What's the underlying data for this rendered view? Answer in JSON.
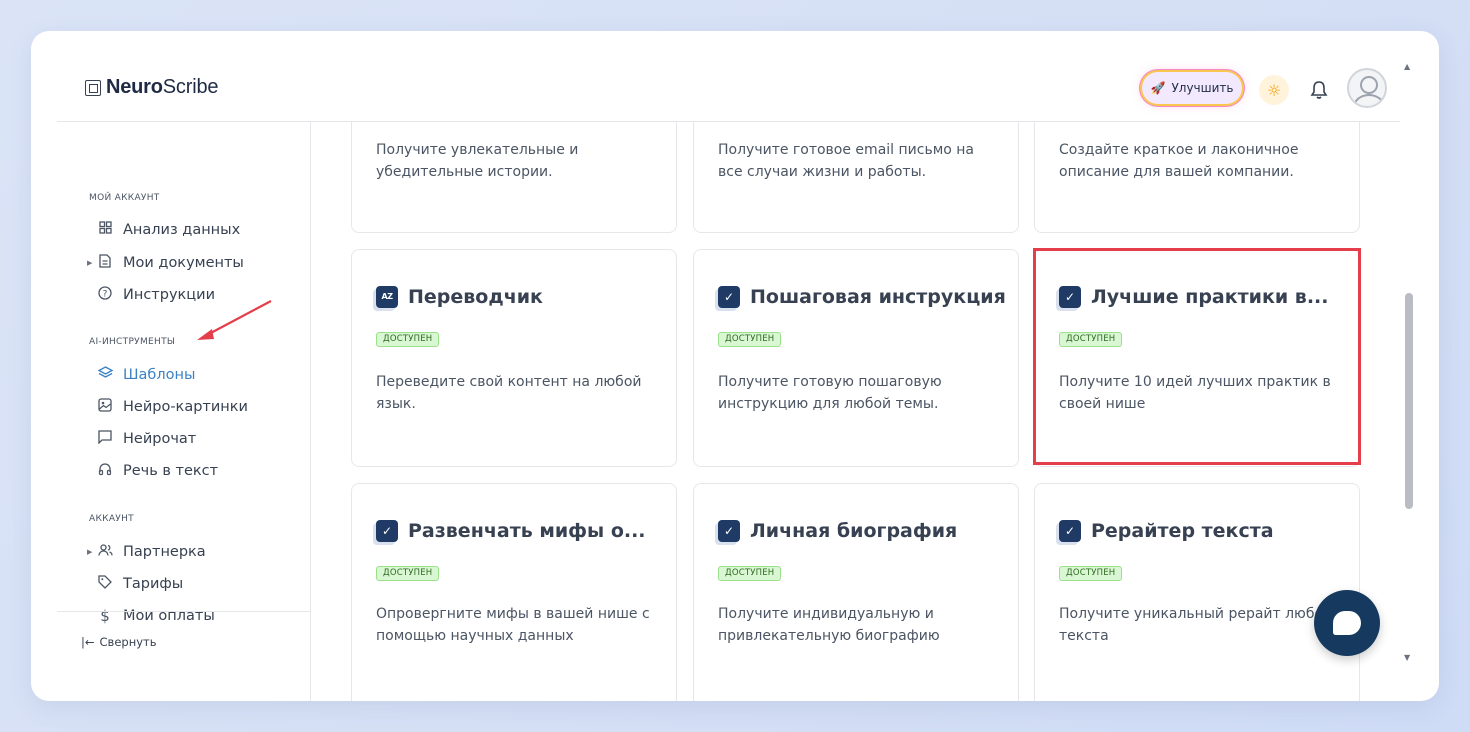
{
  "brand": {
    "bold": "Neuro",
    "light": "Scribe"
  },
  "header": {
    "upgrade_label": "Улучшить"
  },
  "sidebar": {
    "sections": [
      {
        "label": "МОЙ АККАУНТ"
      },
      {
        "label": "AI-ИНСТРУМЕНТЫ"
      },
      {
        "label": "АККАУНТ"
      }
    ],
    "items": [
      {
        "label": "Анализ данных",
        "icon": "grid-icon"
      },
      {
        "label": "Мои документы",
        "icon": "document-icon"
      },
      {
        "label": "Инструкции",
        "icon": "help-circle-icon"
      },
      {
        "label": "Шаблоны",
        "icon": "layers-icon",
        "active": true
      },
      {
        "label": "Нейро-картинки",
        "icon": "image-icon"
      },
      {
        "label": "Нейрочат",
        "icon": "chat-icon"
      },
      {
        "label": "Речь в текст",
        "icon": "headphones-icon"
      },
      {
        "label": "Партнерка",
        "icon": "users-icon"
      },
      {
        "label": "Тарифы",
        "icon": "tag-icon"
      },
      {
        "label": "Мои оплаты",
        "icon": "dollar-icon"
      }
    ],
    "collapse_label": "Свернуть"
  },
  "templates": {
    "badge": "ДОСТУПЕН",
    "top_row": [
      {
        "desc": "Получите увлекательные и убедительные истории."
      },
      {
        "desc": "Получите готовое email письмо на все случаи жизни и работы."
      },
      {
        "desc": "Создайте краткое и лаконичное описание для вашей компании."
      }
    ],
    "cards": [
      {
        "title": "Переводчик",
        "desc": "Переведите свой контент на любой язык.",
        "icon": "translate-icon"
      },
      {
        "title": "Пошаговая инструкция",
        "desc": "Получите готовую пошаговую инструкцию для любой темы.",
        "icon": "checkbox-icon"
      },
      {
        "title": "Лучшие практики в...",
        "desc": "Получите 10 идей лучших практик в своей нише",
        "icon": "checkbox-icon",
        "highlighted": true
      },
      {
        "title": "Развенчать мифы о...",
        "desc": "Опровергните мифы в вашей нише с помощью научных данных",
        "icon": "checkbox-icon"
      },
      {
        "title": "Личная биография",
        "desc": "Получите индивидуальную и привлекательную биографию",
        "icon": "checkbox-icon"
      },
      {
        "title": "Рерайтер текста",
        "desc": "Получите уникальный рерайт любого текста",
        "icon": "checkbox-icon"
      }
    ]
  },
  "colors": {
    "accent": "#3b82c4",
    "highlight": "#e53e4b",
    "badge_bg": "#d9f7d2",
    "chat_button": "#163a5f"
  }
}
